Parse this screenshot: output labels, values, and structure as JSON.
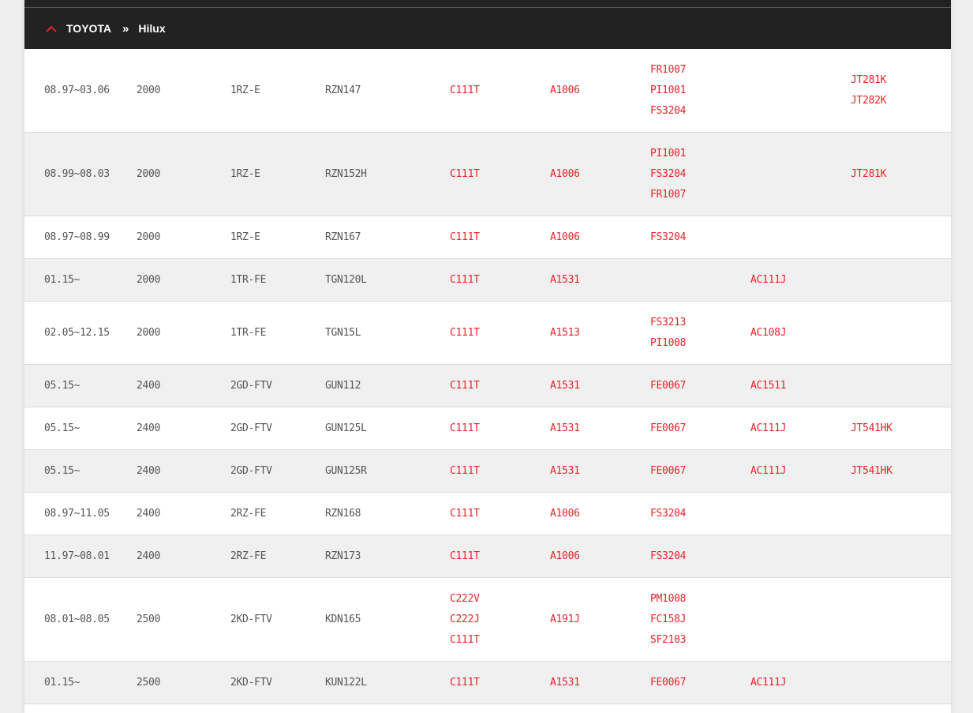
{
  "breadcrumb": {
    "brand": "TOYOTA",
    "separator": "»",
    "model": "Hilux"
  },
  "colors": {
    "accent": "#e8242a",
    "header_bg": "#222222",
    "row_alt": "#f0f0f0",
    "text": "#555555"
  },
  "icons": {
    "toggle": "chevron-up-icon"
  },
  "rows": [
    {
      "period": "08.97~03.06",
      "cc": "2000",
      "engine": "1RZ-E",
      "model": "RZN147",
      "col5": [
        "C111T"
      ],
      "col6": [
        "A1006"
      ],
      "col7": [
        "FR1007",
        "PI1001",
        "FS3204"
      ],
      "col8": [],
      "col9": [
        "JT281K",
        "JT282K"
      ]
    },
    {
      "period": "08.99~08.03",
      "cc": "2000",
      "engine": "1RZ-E",
      "model": "RZN152H",
      "col5": [
        "C111T"
      ],
      "col6": [
        "A1006"
      ],
      "col7": [
        "PI1001",
        "FS3204",
        "FR1007"
      ],
      "col8": [],
      "col9": [
        "JT281K"
      ]
    },
    {
      "period": "08.97~08.99",
      "cc": "2000",
      "engine": "1RZ-E",
      "model": "RZN167",
      "col5": [
        "C111T"
      ],
      "col6": [
        "A1006"
      ],
      "col7": [
        "FS3204"
      ],
      "col8": [],
      "col9": []
    },
    {
      "period": "01.15~",
      "cc": "2000",
      "engine": "1TR-FE",
      "model": "TGN120L",
      "col5": [
        "C111T"
      ],
      "col6": [
        "A1531"
      ],
      "col7": [],
      "col8": [
        "AC111J"
      ],
      "col9": []
    },
    {
      "period": "02.05~12.15",
      "cc": "2000",
      "engine": "1TR-FE",
      "model": "TGN15L",
      "col5": [
        "C111T"
      ],
      "col6": [
        "A1513"
      ],
      "col7": [
        "FS3213",
        "PI1008"
      ],
      "col8": [
        "AC108J"
      ],
      "col9": []
    },
    {
      "period": "05.15~",
      "cc": "2400",
      "engine": "2GD-FTV",
      "model": "GUN112",
      "col5": [
        "C111T"
      ],
      "col6": [
        "A1531"
      ],
      "col7": [
        "FE0067"
      ],
      "col8": [
        "AC1511"
      ],
      "col9": []
    },
    {
      "period": "05.15~",
      "cc": "2400",
      "engine": "2GD-FTV",
      "model": "GUN125L",
      "col5": [
        "C111T"
      ],
      "col6": [
        "A1531"
      ],
      "col7": [
        "FE0067"
      ],
      "col8": [
        "AC111J"
      ],
      "col9": [
        "JT541HK"
      ]
    },
    {
      "period": "05.15~",
      "cc": "2400",
      "engine": "2GD-FTV",
      "model": "GUN125R",
      "col5": [
        "C111T"
      ],
      "col6": [
        "A1531"
      ],
      "col7": [
        "FE0067"
      ],
      "col8": [
        "AC111J"
      ],
      "col9": [
        "JT541HK"
      ]
    },
    {
      "period": "08.97~11.05",
      "cc": "2400",
      "engine": "2RZ-FE",
      "model": "RZN168",
      "col5": [
        "C111T"
      ],
      "col6": [
        "A1006"
      ],
      "col7": [
        "FS3204"
      ],
      "col8": [],
      "col9": []
    },
    {
      "period": "11.97~08.01",
      "cc": "2400",
      "engine": "2RZ-FE",
      "model": "RZN173",
      "col5": [
        "C111T"
      ],
      "col6": [
        "A1006"
      ],
      "col7": [
        "FS3204"
      ],
      "col8": [],
      "col9": []
    },
    {
      "period": "08.01~08.05",
      "cc": "2500",
      "engine": "2KD-FTV",
      "model": "KDN165",
      "col5": [
        "C222V",
        "C222J",
        "C111T"
      ],
      "col6": [
        "A191J"
      ],
      "col7": [
        "PM1008",
        "FC158J",
        "SF2103"
      ],
      "col8": [],
      "col9": []
    },
    {
      "period": "01.15~",
      "cc": "2500",
      "engine": "2KD-FTV",
      "model": "KUN122L",
      "col5": [
        "C111T"
      ],
      "col6": [
        "A1531"
      ],
      "col7": [
        "FE0067"
      ],
      "col8": [
        "AC111J"
      ],
      "col9": []
    }
  ]
}
